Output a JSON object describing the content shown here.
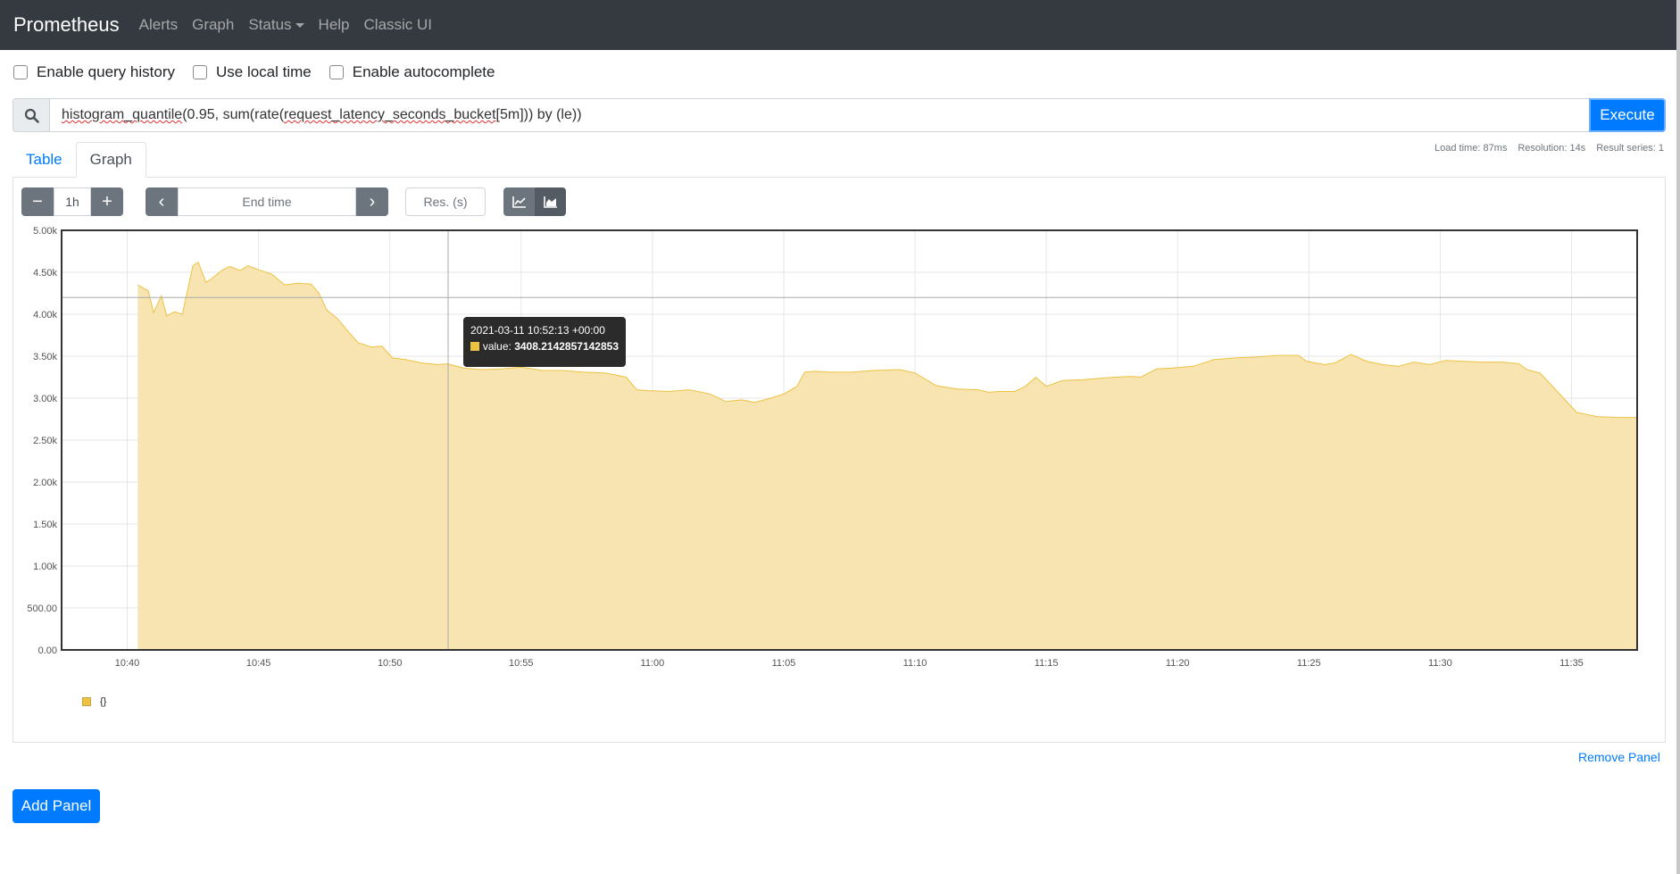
{
  "navbar": {
    "brand": "Prometheus",
    "links": [
      "Alerts",
      "Graph",
      "Status",
      "Help",
      "Classic UI"
    ]
  },
  "options": {
    "query_history": "Enable query history",
    "local_time": "Use local time",
    "autocomplete": "Enable autocomplete"
  },
  "query": {
    "parts": [
      "histogram_quantile",
      "(0.95, sum(rate(",
      "request_latency_seconds_bucket",
      "[5m])) by (le))"
    ],
    "execute_label": "Execute"
  },
  "stats": {
    "load_time": "Load time: 87ms",
    "resolution": "Resolution: 14s",
    "result_series": "Result series: 1"
  },
  "tabs": {
    "table": "Table",
    "graph": "Graph"
  },
  "controls": {
    "minus": "−",
    "range": "1h",
    "plus": "+",
    "prev": "‹",
    "end_time_placeholder": "End time",
    "next": "›",
    "resolution_placeholder": "Res. (s)"
  },
  "tooltip": {
    "time": "2021-03-11 10:52:13 +00:00",
    "value_label": "value:",
    "value": "3408.2142857142853"
  },
  "legend": {
    "series_label": "{}"
  },
  "actions": {
    "remove_panel": "Remove Panel",
    "add_panel": "Add Panel"
  },
  "colors": {
    "series_fill": "#f7e4b1",
    "series_line": "#edc240",
    "primary": "#007bff",
    "navbar": "#343a40"
  },
  "chart_data": {
    "type": "area",
    "ylim": [
      0,
      5000
    ],
    "y_ticks": [
      "0.00",
      "500.00",
      "1.00k",
      "1.50k",
      "2.00k",
      "2.50k",
      "3.00k",
      "3.50k",
      "4.00k",
      "4.50k",
      "5.00k"
    ],
    "x_ticks": [
      "10:40",
      "10:45",
      "10:50",
      "10:55",
      "11:00",
      "11:05",
      "11:10",
      "11:15",
      "11:20",
      "11:25",
      "11:30",
      "11:35"
    ],
    "x_tick_minutes": [
      40,
      45,
      50,
      55,
      60,
      65,
      70,
      75,
      80,
      85,
      90,
      95
    ],
    "x_range_minutes": [
      37.5,
      97.5
    ],
    "series": [
      {
        "x": [
          40.4,
          40.8,
          41.0,
          41.3,
          41.5,
          41.8,
          42.1,
          42.5,
          42.7,
          43.0,
          43.2,
          43.6,
          43.9,
          44.3,
          44.6,
          45.0,
          45.5,
          46.0,
          46.5,
          47.0,
          47.3,
          47.6,
          48.0,
          48.4,
          48.8,
          49.3,
          49.7,
          50.1,
          50.6,
          51.2,
          51.8,
          52.2,
          52.8,
          53.5,
          54.3,
          55.0,
          55.8,
          56.6,
          57.4,
          58.2,
          59.0,
          59.4,
          59.8,
          60.6,
          61.4,
          62.2,
          62.8,
          63.4,
          63.9,
          64.5,
          65.0,
          65.5,
          65.8,
          66.2,
          66.8,
          67.6,
          68.4,
          69.4,
          70.0,
          70.8,
          71.6,
          72.4,
          72.8,
          73.2,
          73.8,
          74.2,
          74.6,
          75.0,
          75.6,
          76.4,
          77.2,
          77.6,
          78.2,
          78.6,
          79.2,
          79.8,
          80.6,
          81.4,
          82.2,
          83.0,
          83.8,
          84.6,
          84.9,
          85.6,
          86.0,
          86.6,
          87.2,
          87.8,
          88.4,
          89.0,
          89.6,
          90.2,
          90.8,
          91.6,
          92.4,
          93.0,
          93.3,
          93.8,
          94.4,
          95.2,
          96.0,
          96.8,
          97.5
        ],
        "values": [
          4350,
          4280,
          4020,
          4220,
          3980,
          4030,
          4000,
          4580,
          4620,
          4380,
          4420,
          4520,
          4570,
          4520,
          4580,
          4530,
          4480,
          4350,
          4370,
          4360,
          4250,
          4050,
          3950,
          3800,
          3660,
          3610,
          3620,
          3480,
          3460,
          3420,
          3400,
          3408,
          3360,
          3340,
          3350,
          3370,
          3330,
          3330,
          3310,
          3300,
          3250,
          3100,
          3090,
          3080,
          3100,
          3050,
          2960,
          2980,
          2950,
          3000,
          3050,
          3140,
          3310,
          3320,
          3310,
          3310,
          3330,
          3340,
          3300,
          3150,
          3110,
          3100,
          3070,
          3080,
          3080,
          3140,
          3250,
          3140,
          3210,
          3220,
          3240,
          3250,
          3260,
          3250,
          3350,
          3360,
          3380,
          3460,
          3480,
          3490,
          3510,
          3510,
          3440,
          3400,
          3420,
          3520,
          3440,
          3400,
          3380,
          3430,
          3400,
          3450,
          3440,
          3430,
          3430,
          3410,
          3340,
          3300,
          3100,
          2830,
          2780,
          2770,
          2770
        ]
      }
    ]
  }
}
